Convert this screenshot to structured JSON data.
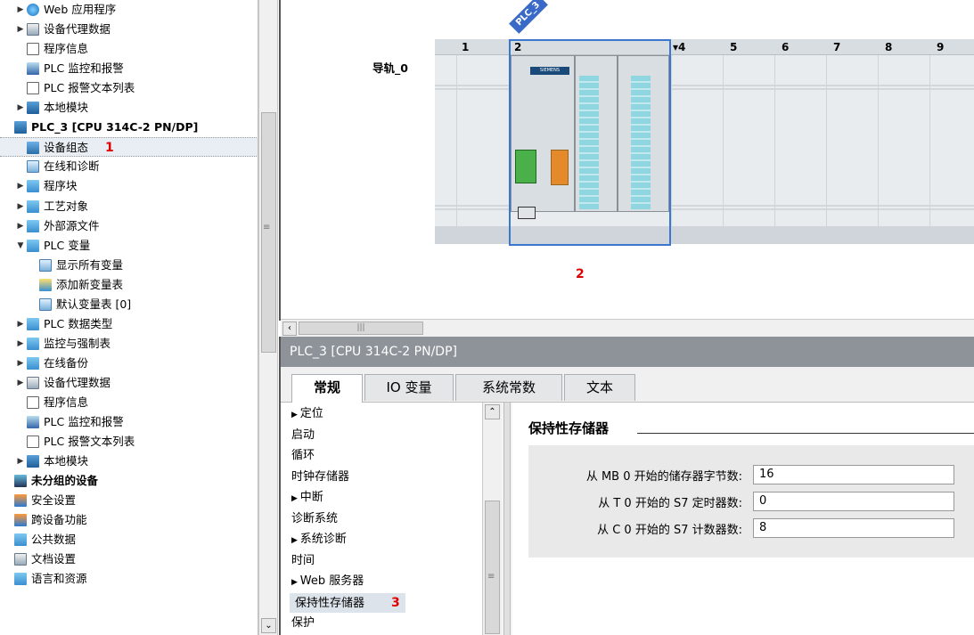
{
  "tree": {
    "items": [
      {
        "label": "Web 应用程序",
        "indent": 1,
        "expand": "right",
        "icon": "globe"
      },
      {
        "label": "设备代理数据",
        "indent": 1,
        "expand": "right",
        "icon": "doc2"
      },
      {
        "label": "程序信息",
        "indent": 1,
        "expand": "",
        "icon": "doc"
      },
      {
        "label": "PLC 监控和报警",
        "indent": 1,
        "expand": "",
        "icon": "monitor"
      },
      {
        "label": "PLC 报警文本列表",
        "indent": 1,
        "expand": "",
        "icon": "doc"
      },
      {
        "label": "本地模块",
        "indent": 1,
        "expand": "right",
        "icon": "dev"
      },
      {
        "label": "PLC_3 [CPU 314C-2 PN/DP]",
        "indent": 0,
        "expand": "",
        "icon": "dev",
        "bold": true
      },
      {
        "label": "设备组态",
        "indent": 1,
        "expand": "",
        "icon": "blk",
        "selected": true,
        "marker": "1"
      },
      {
        "label": "在线和诊断",
        "indent": 1,
        "expand": "",
        "icon": "tag"
      },
      {
        "label": "程序块",
        "indent": 1,
        "expand": "right",
        "icon": "folder"
      },
      {
        "label": "工艺对象",
        "indent": 1,
        "expand": "right",
        "icon": "folder"
      },
      {
        "label": "外部源文件",
        "indent": 1,
        "expand": "right",
        "icon": "folder"
      },
      {
        "label": "PLC 变量",
        "indent": 1,
        "expand": "down",
        "icon": "folder"
      },
      {
        "label": "显示所有变量",
        "indent": 2,
        "expand": "",
        "icon": "tag"
      },
      {
        "label": "添加新变量表",
        "indent": 2,
        "expand": "",
        "icon": "tagnew"
      },
      {
        "label": "默认变量表 [0]",
        "indent": 2,
        "expand": "",
        "icon": "tag"
      },
      {
        "label": "PLC 数据类型",
        "indent": 1,
        "expand": "right",
        "icon": "folder"
      },
      {
        "label": "监控与强制表",
        "indent": 1,
        "expand": "right",
        "icon": "folder"
      },
      {
        "label": "在线备份",
        "indent": 1,
        "expand": "right",
        "icon": "folder"
      },
      {
        "label": "设备代理数据",
        "indent": 1,
        "expand": "right",
        "icon": "doc2"
      },
      {
        "label": "程序信息",
        "indent": 1,
        "expand": "",
        "icon": "doc"
      },
      {
        "label": "PLC 监控和报警",
        "indent": 1,
        "expand": "",
        "icon": "monitor"
      },
      {
        "label": "PLC 报警文本列表",
        "indent": 1,
        "expand": "",
        "icon": "doc"
      },
      {
        "label": "本地模块",
        "indent": 1,
        "expand": "right",
        "icon": "dev"
      },
      {
        "label": "未分组的设备",
        "indent": 0,
        "expand": "",
        "icon": "ungroup",
        "bold": true
      },
      {
        "label": "安全设置",
        "indent": 0,
        "expand": "",
        "icon": "lock"
      },
      {
        "label": "跨设备功能",
        "indent": 0,
        "expand": "",
        "icon": "lock"
      },
      {
        "label": "公共数据",
        "indent": 0,
        "expand": "",
        "icon": "folder"
      },
      {
        "label": "文档设置",
        "indent": 0,
        "expand": "",
        "icon": "doc2"
      },
      {
        "label": "语言和资源",
        "indent": 0,
        "expand": "",
        "icon": "folder"
      }
    ]
  },
  "device_view": {
    "rail_label": "导轨_0",
    "plc_tag": "PLC_3",
    "slots": [
      "1",
      "2",
      "▾4",
      "5",
      "6",
      "7",
      "8",
      "9"
    ],
    "cpu_logo": "SIEMENS",
    "marker": "2"
  },
  "inspector": {
    "title": "PLC_3 [CPU 314C-2 PN/DP]",
    "tabs": [
      "常规",
      "IO 变量",
      "系统常数",
      "文本"
    ],
    "active_tab": "常规",
    "nav": [
      {
        "label": "定位",
        "expand": true
      },
      {
        "label": "启动",
        "expand": false
      },
      {
        "label": "循环",
        "expand": false
      },
      {
        "label": "时钟存储器",
        "expand": false
      },
      {
        "label": "中断",
        "expand": true
      },
      {
        "label": "诊断系统",
        "expand": false
      },
      {
        "label": "系统诊断",
        "expand": true
      },
      {
        "label": "时间",
        "expand": false
      },
      {
        "label": "Web 服务器",
        "expand": true
      },
      {
        "label": "保持性存储器",
        "expand": false,
        "selected": true
      },
      {
        "label": "保护",
        "expand": false
      }
    ],
    "nav_marker": "3",
    "section_title": "保持性存储器",
    "fields": [
      {
        "label": "从 MB 0 开始的储存器字节数:",
        "value": "16"
      },
      {
        "label": "从 T 0 开始的 S7 定时器数:",
        "value": "0"
      },
      {
        "label": "从 C 0 开始的 S7 计数器数:",
        "value": "8"
      }
    ]
  }
}
